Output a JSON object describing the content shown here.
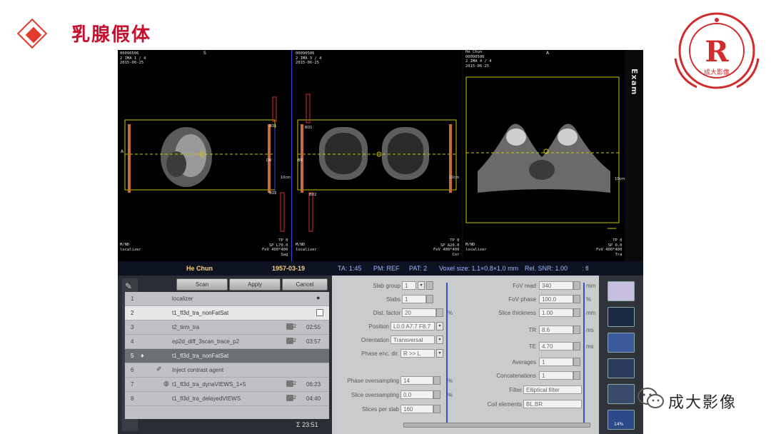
{
  "slide": {
    "title": "乳腺假体",
    "accent_color": "#c8102e",
    "logo_letter": "R",
    "logo_text": "成大影像",
    "watermark": "成大影像"
  },
  "viewers": [
    {
      "id_line1": "00090506",
      "id_line2": "2 IMA 1 / 4",
      "id_line3": "2015-06-25",
      "orient_top": "S",
      "labels": [
        "BO1",
        "BO2",
        "DR",
        "10cm"
      ],
      "left_edge": "A",
      "bottom_left": "M/ND\nlocalizer",
      "bottom_right": "TP 0\nSP L70.0\nFoV 400*400\nSag"
    },
    {
      "id_line1": "00090506",
      "id_line2": "2 IMA 3 / 4",
      "id_line3": "2015-06-25",
      "labels": [
        "BO1",
        "BO2",
        "BR",
        "10cm"
      ],
      "bottom_left": "M/ND\nlocalizer",
      "bottom_right": "TP 0\nSP A20.0\nFoV 400*400\nCor"
    },
    {
      "id_line1": "He Chun",
      "id_line2": "00090506",
      "id_line3": "2 IMA 4 / 4",
      "id_line4": "2015-06-25",
      "orient_top": "A",
      "labels": [
        "10cm"
      ],
      "bottom_left": "M/ND\nlocalizer",
      "bottom_right": "TP 0\nSP 0.0\nFoV 400*400\nTra"
    }
  ],
  "exam_tab": "Exam",
  "patient_bar": {
    "name": "He Chun",
    "dob": "1957-03-19",
    "ta": "TA: 1:45",
    "pm": "PM: REF",
    "pat": "PAT: 2",
    "voxel": "Voxel size: 1.1×0.8×1.0 mm",
    "snr": "Rel. SNR: 1.00",
    "fl": ": fl"
  },
  "protocol_buttons": {
    "scan": "Scan",
    "apply": "Apply",
    "cancel": "Cancel"
  },
  "protocols": [
    {
      "num": "1",
      "name": "localizer",
      "ta": ""
    },
    {
      "num": "2",
      "name": "t1_fl3d_tra_nonFatSat",
      "ta": ""
    },
    {
      "num": "3",
      "name": "t2_tirm_tra",
      "ta": "02:55",
      "count": "2"
    },
    {
      "num": "4",
      "name": "ep2d_diff_3scan_trace_p2",
      "ta": "03:57",
      "count": "2"
    },
    {
      "num": "5",
      "name": "t1_fl3d_tra_nonFatSat",
      "ta": ""
    },
    {
      "num": "6",
      "name": "Inject contrast agent",
      "ta": ""
    },
    {
      "num": "7",
      "name": "t1_fl3d_tra_dynaVIEWS_1+5",
      "ta": "06:23",
      "count": "2"
    },
    {
      "num": "8",
      "name": "t1_fl3d_tra_delayedVIEWS",
      "ta": "04:40",
      "count": "2"
    }
  ],
  "total_time": "Σ 23:51",
  "params_left": [
    {
      "label": "Slab group",
      "value": "1"
    },
    {
      "label": "Slabs",
      "value": "1"
    },
    {
      "label": "Dist. factor",
      "value": "20",
      "unit": "%"
    },
    {
      "label": "Position",
      "value": "L0.0 A7.7 F8.7"
    },
    {
      "label": "Orientation",
      "value": "Transversal"
    },
    {
      "label": "Phase enc. dir.",
      "value": "R >> L"
    },
    {
      "label": "Phase oversampling",
      "value": "14",
      "unit": "%"
    },
    {
      "label": "Slice oversampling",
      "value": "0.0",
      "unit": "%"
    },
    {
      "label": "Slices per slab",
      "value": "160"
    }
  ],
  "params_right": [
    {
      "label": "FoV read",
      "value": "340",
      "unit": "mm"
    },
    {
      "label": "FoV phase",
      "value": "100.0",
      "unit": "%"
    },
    {
      "label": "Slice thickness",
      "value": "1.00",
      "unit": "mm"
    },
    {
      "label": "TR",
      "value": "8.6",
      "unit": "ms"
    },
    {
      "label": "TE",
      "value": "4.70",
      "unit": "ms"
    },
    {
      "label": "Averages",
      "value": "1"
    },
    {
      "label": "Concatenations",
      "value": "1"
    },
    {
      "label": "Filter",
      "value": "Elliptical filter"
    },
    {
      "label": "Coil elements",
      "value": "BL,BR"
    }
  ],
  "right_strip_value": "14%"
}
